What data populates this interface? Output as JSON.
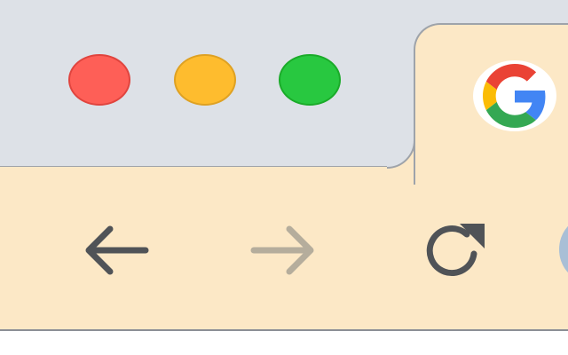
{
  "window": {
    "controls": {
      "close": {
        "color": "#fe5f57",
        "icon": "close-traffic-light"
      },
      "minimize": {
        "color": "#febc2e",
        "icon": "minimize-traffic-light"
      },
      "zoom": {
        "color": "#28c840",
        "icon": "zoom-traffic-light"
      }
    }
  },
  "tab": {
    "favicon": "google-g-icon",
    "background": "#fce8c6"
  },
  "toolbar": {
    "background": "#fce8c6",
    "buttons": {
      "back": {
        "icon": "arrow-left-icon",
        "enabled": true
      },
      "forward": {
        "icon": "arrow-right-icon",
        "enabled": false
      },
      "reload": {
        "icon": "reload-icon",
        "enabled": true
      }
    }
  },
  "colors": {
    "tabstrip": "#dde1e7",
    "icon_active": "#505357",
    "icon_disabled": "#b5ad9c"
  }
}
